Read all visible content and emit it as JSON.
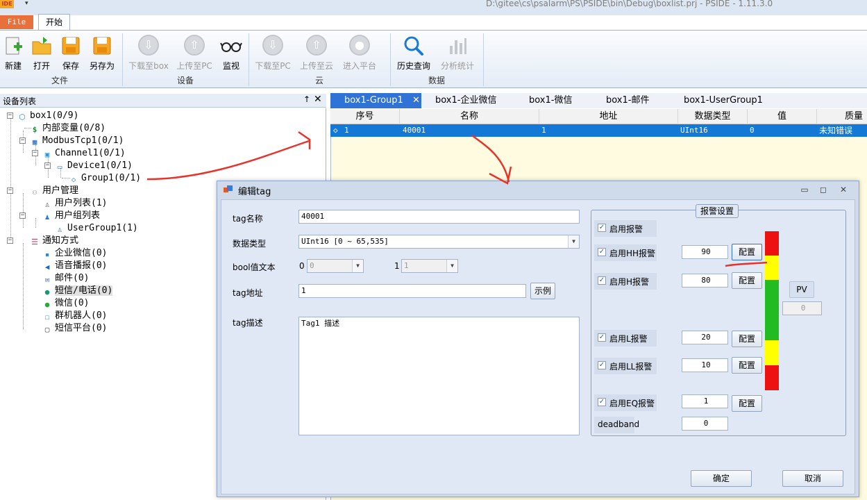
{
  "window": {
    "logo": "IDE",
    "quick_access": "▾",
    "title": "D:\\gitee\\cs\\psalarm\\PS\\PSIDE\\bin\\Debug\\boxlist.prj - PSIDE - 1.11.3.0"
  },
  "ribbon": {
    "tabs": {
      "file": "File",
      "start": "开始"
    },
    "groups": [
      {
        "label": "文件",
        "buttons": [
          "新建",
          "打开",
          "保存",
          "另存为"
        ]
      },
      {
        "label": "设备",
        "buttons": [
          "下载至box",
          "上传至PC",
          "监视"
        ]
      },
      {
        "label": "云",
        "buttons": [
          "下载至PC",
          "上传至云",
          "进入平台"
        ]
      },
      {
        "label": "数据",
        "buttons": [
          "历史查询",
          "分析统计"
        ]
      }
    ]
  },
  "device_panel": {
    "title": "设备列表",
    "pin": "↑",
    "close": "✕",
    "tree": [
      "box1(0/9)",
      "内部变量(0/8)",
      "ModbusTcp1(0/1)",
      "Channel1(0/1)",
      "Device1(0/1)",
      "Group1(0/1)",
      "用户管理",
      "用户列表(1)",
      "用户组列表",
      "UserGroup1(1)",
      "通知方式",
      "企业微信(0)",
      "语音播报(0)",
      "邮件(0)",
      "短信/电话(0)",
      "微信(0)",
      "群机器人(0)",
      "短信平台(0)"
    ]
  },
  "doc_tabs": {
    "tabs": [
      "box1-Group1",
      "box1-企业微信",
      "box1-微信",
      "box1-邮件",
      "box1-UserGroup1"
    ],
    "close": "✕"
  },
  "grid": {
    "columns": [
      "序号",
      "名称",
      "地址",
      "数据类型",
      "值",
      "质量"
    ],
    "rows": [
      {
        "index": "1",
        "name": "40001",
        "address": "1",
        "type": "UInt16",
        "value": "0",
        "quality": "未知错误"
      }
    ]
  },
  "dialog": {
    "title": "编辑tag",
    "window_buttons": [
      "▭",
      "◻",
      "✕"
    ],
    "fields": {
      "tag_name_label": "tag名称",
      "tag_name_value": "40001",
      "data_type_label": "数据类型",
      "data_type_value": "UInt16   [0 ~ 65,535]",
      "bool_label": "bool值文本",
      "bool0_prefix": "0",
      "bool0_value": "0",
      "bool1_prefix": "1",
      "bool1_value": "1",
      "address_label": "tag地址",
      "address_value": "1",
      "example_button": "示例",
      "desc_label": "tag描述",
      "desc_value": "Tag1 描述"
    },
    "alarm": {
      "legend": "报警设置",
      "enable_alarm": "启用报警",
      "hh_label": "启用HH报警",
      "hh_value": "90",
      "h_label": "启用H报警",
      "h_value": "80",
      "l_label": "启用L报警",
      "l_value": "20",
      "ll_label": "启用LL报警",
      "ll_value": "10",
      "eq_label": "启用EQ报警",
      "eq_value": "1",
      "deadband_label": "deadband",
      "deadband_value": "0",
      "config_button": "配置",
      "pv_label": "PV",
      "pv_value": "0",
      "check_mark": "✓",
      "colors": {
        "red": "#ee1111",
        "yellow": "#ffff00",
        "green": "#22bb22"
      }
    },
    "ok_button": "确定",
    "cancel_button": "取消"
  }
}
